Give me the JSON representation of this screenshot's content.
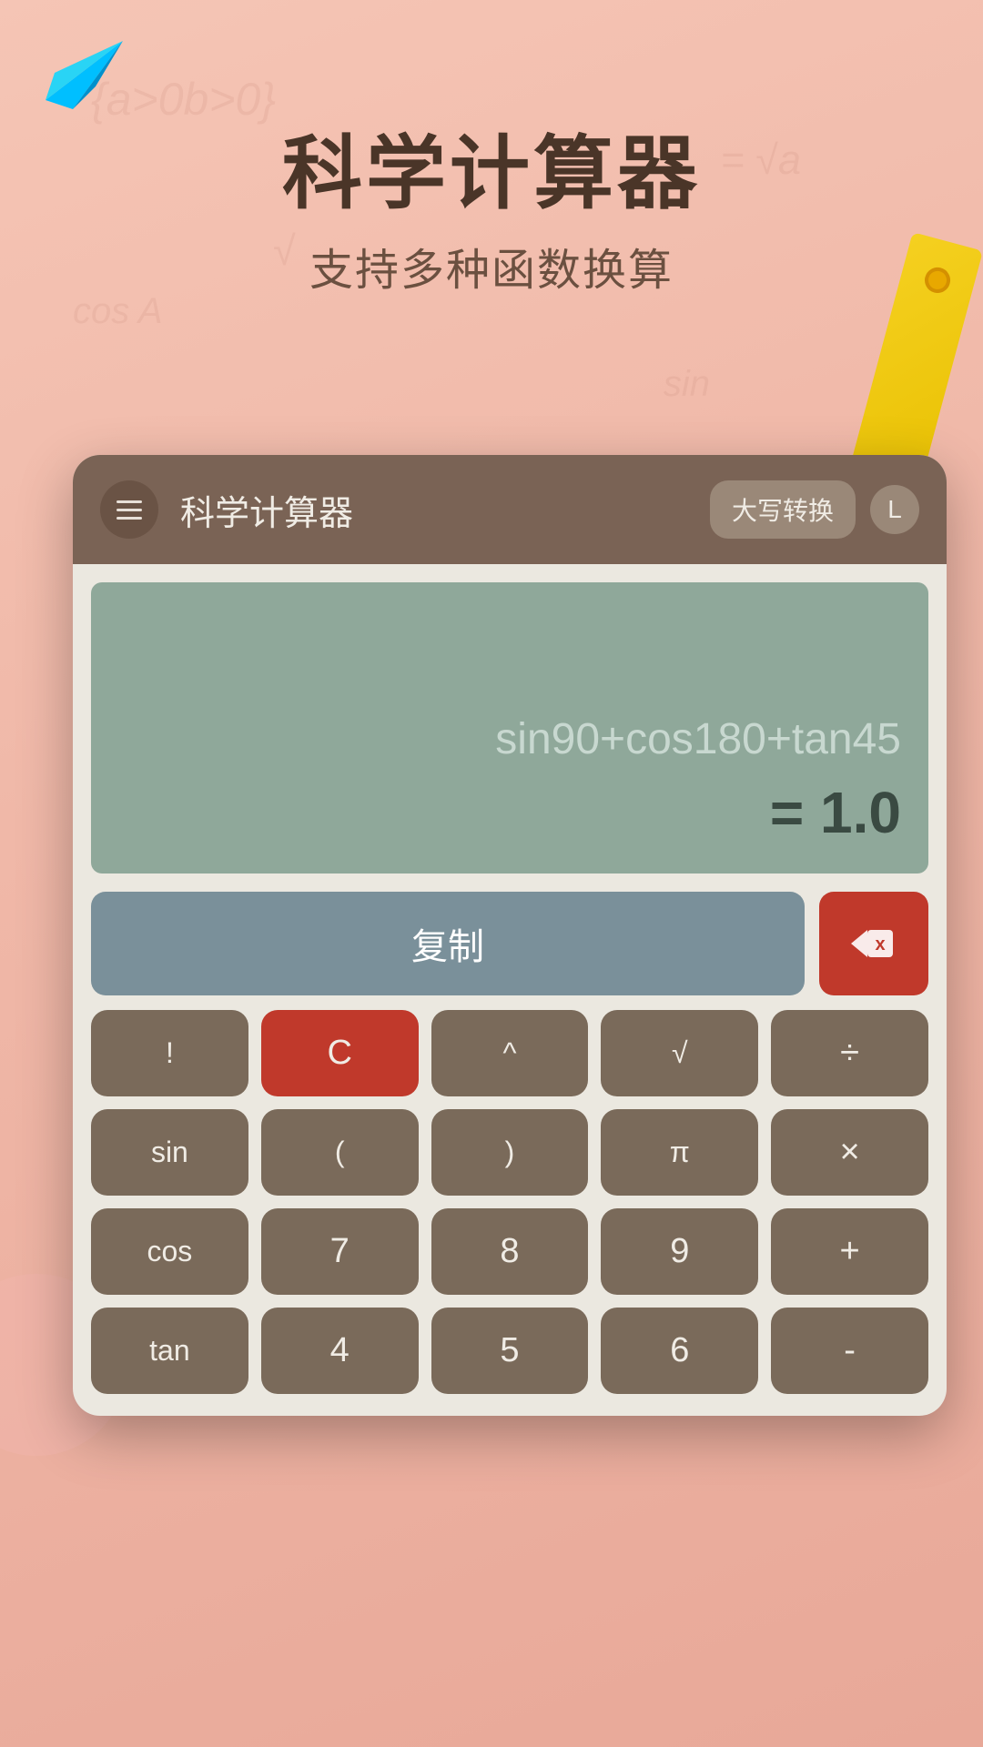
{
  "app": {
    "title": "科学计算器",
    "subtitle": "支持多种函数换算"
  },
  "header": {
    "title": "科学计算器",
    "convert_btn": "大写转换",
    "history_icon": "L"
  },
  "display": {
    "expression": "sin90+cos180+tan45",
    "result": "= 1.0"
  },
  "buttons": {
    "copy": "复制",
    "backspace": "⌫",
    "row1": [
      "!",
      "C",
      "^",
      "√",
      "÷"
    ],
    "row2": [
      "sin",
      "(",
      ")",
      "π",
      "×"
    ],
    "row3": [
      "cos",
      "7",
      "8",
      "9",
      "+"
    ],
    "row4": [
      "tan",
      "4",
      "5",
      "6",
      "-"
    ]
  },
  "colors": {
    "background_start": "#f5c5b5",
    "background_end": "#e8a898",
    "calculator_bg": "#ebe8e0",
    "header_bg": "#7a6355",
    "display_bg": "#8fa89a",
    "key_normal": "#7a6a5a",
    "key_red": "#c0392b",
    "copy_btn": "#7a909a"
  }
}
